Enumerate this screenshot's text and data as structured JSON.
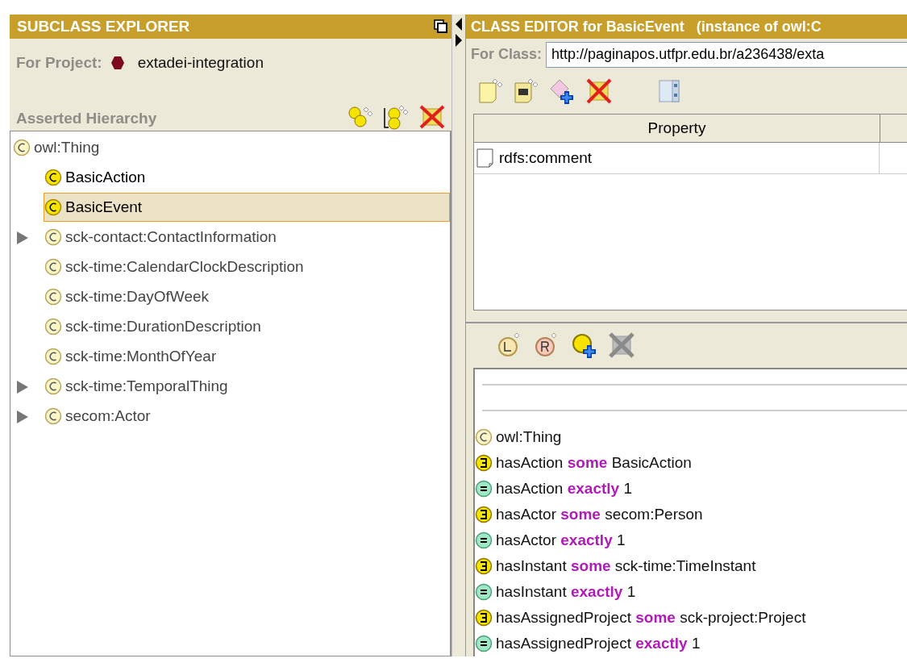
{
  "subclass_explorer": {
    "title": "SUBCLASS EXPLORER",
    "project_label": "For Project:",
    "project": "extadei-integration",
    "hierarchy_label": "Asserted Hierarchy",
    "root": {
      "label": "owl:Thing",
      "kind": "imported",
      "selected": false,
      "children": [
        {
          "label": "BasicAction",
          "kind": "own",
          "expandable": false,
          "selected": false
        },
        {
          "label": "BasicEvent",
          "kind": "own",
          "expandable": false,
          "selected": true
        },
        {
          "label": "sck-contact:ContactInformation",
          "kind": "imported",
          "expandable": true,
          "selected": false
        },
        {
          "label": "sck-time:CalendarClockDescription",
          "kind": "imported",
          "expandable": false,
          "selected": false
        },
        {
          "label": "sck-time:DayOfWeek",
          "kind": "imported",
          "expandable": false,
          "selected": false
        },
        {
          "label": "sck-time:DurationDescription",
          "kind": "imported",
          "expandable": false,
          "selected": false
        },
        {
          "label": "sck-time:MonthOfYear",
          "kind": "imported",
          "expandable": false,
          "selected": false
        },
        {
          "label": "sck-time:TemporalThing",
          "kind": "imported",
          "expandable": true,
          "selected": false
        },
        {
          "label": "secom:Actor",
          "kind": "imported",
          "expandable": true,
          "selected": false
        }
      ]
    }
  },
  "class_editor": {
    "title": "CLASS EDITOR for BasicEvent   (instance of owl:C",
    "for_class_label": "For Class:",
    "for_class": "http://paginapos.utfpr.edu.br/a236438/exta",
    "table": {
      "columns": [
        "Property"
      ],
      "rows": [
        {
          "property": "rdfs:comment"
        }
      ]
    },
    "conditions": [
      {
        "kind": "class",
        "text": "owl:Thing"
      },
      {
        "kind": "some",
        "text": "hasAction **some** BasicAction"
      },
      {
        "kind": "exactly",
        "text": "hasAction **exactly** 1"
      },
      {
        "kind": "some",
        "text": "hasActor **some** secom:Person"
      },
      {
        "kind": "exactly",
        "text": "hasActor **exactly** 1"
      },
      {
        "kind": "some",
        "text": "hasInstant **some** sck-time:TimeInstant"
      },
      {
        "kind": "exactly",
        "text": "hasInstant **exactly** 1"
      },
      {
        "kind": "some",
        "text": "hasAssignedProject **some** sck-project:Project"
      },
      {
        "kind": "exactly",
        "text": "hasAssignedProject **exactly** 1"
      }
    ]
  }
}
